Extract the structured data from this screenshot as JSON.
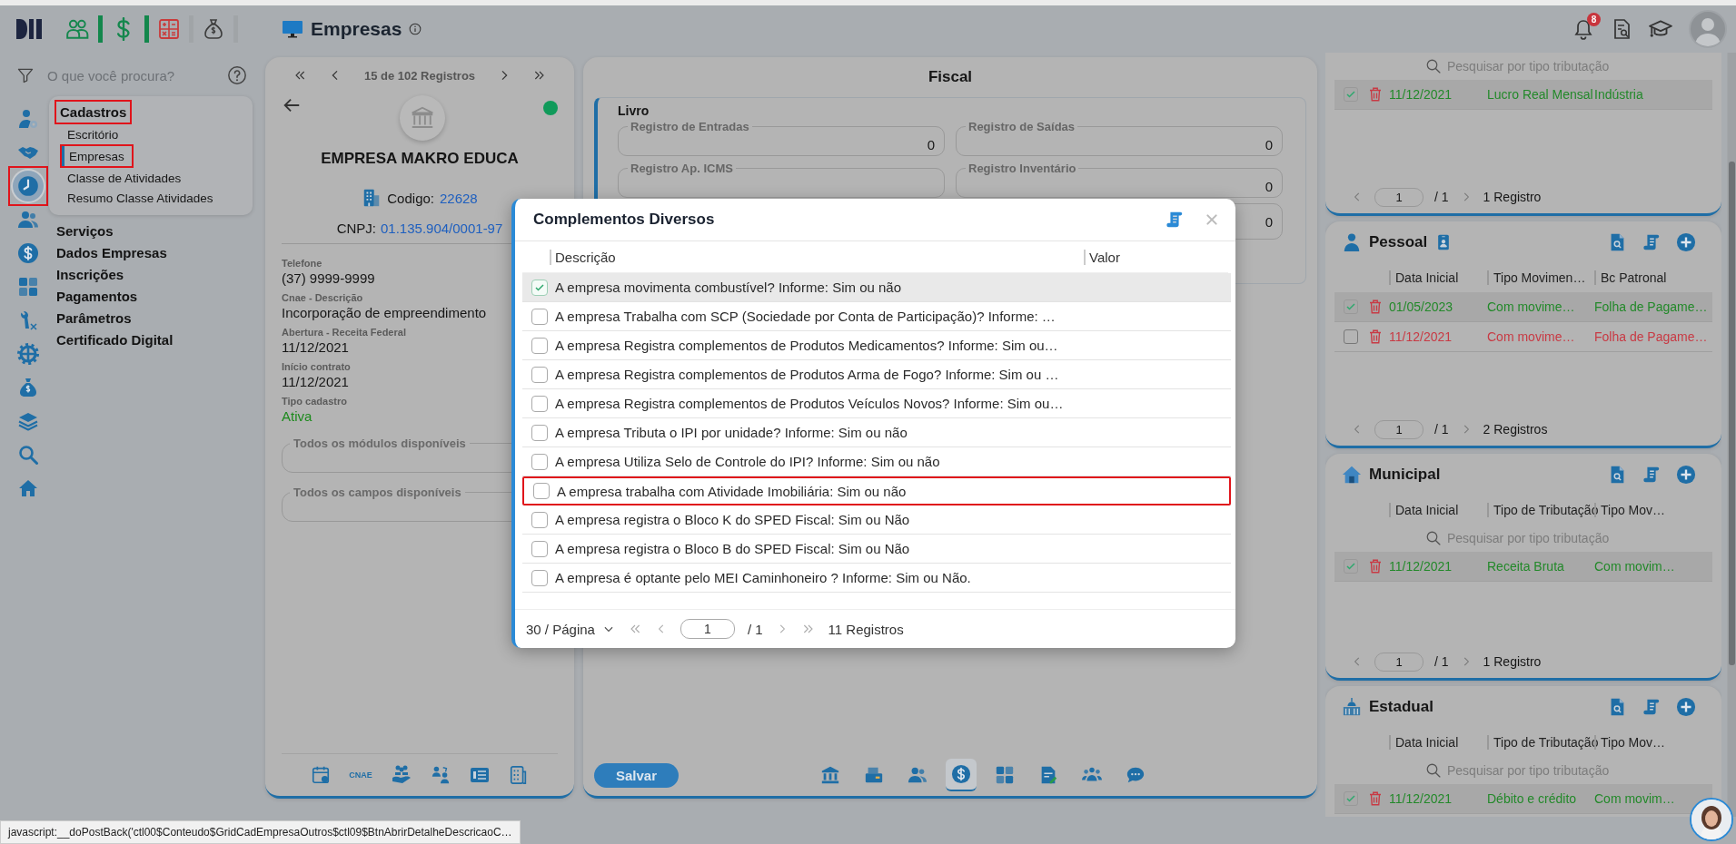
{
  "header": {
    "title": "Empresas",
    "notifications": "8"
  },
  "nav": {
    "search_placeholder": "O que você procura?",
    "rail": [
      {
        "selected": false,
        "highlighted": false
      },
      {
        "selected": false,
        "highlighted": false
      },
      {
        "selected": true,
        "highlighted": true
      },
      {
        "selected": false,
        "highlighted": false
      },
      {
        "selected": false,
        "highlighted": false
      },
      {
        "selected": false,
        "highlighted": false
      },
      {
        "selected": false,
        "highlighted": false
      },
      {
        "selected": false,
        "highlighted": false
      },
      {
        "selected": false,
        "highlighted": false
      },
      {
        "selected": false,
        "highlighted": false
      },
      {
        "selected": false,
        "highlighted": false
      },
      {
        "selected": false,
        "highlighted": false
      }
    ],
    "menu": [
      {
        "label": "Cadastros",
        "highlighted": true,
        "children": [
          {
            "label": "Escritório",
            "selected": false,
            "highlighted": false
          },
          {
            "label": "Empresas",
            "selected": true,
            "highlighted": true
          },
          {
            "label": "Classe de Atividades",
            "selected": false,
            "highlighted": false
          },
          {
            "label": "Resumo Classe Atividades",
            "selected": false,
            "highlighted": false
          }
        ]
      },
      {
        "label": "Serviços",
        "highlighted": false
      },
      {
        "label": "Dados Empresas",
        "highlighted": false
      },
      {
        "label": "Inscrições",
        "highlighted": false
      },
      {
        "label": "Pagamentos",
        "highlighted": false
      },
      {
        "label": "Parâmetros",
        "highlighted": false
      },
      {
        "label": "Certificado Digital",
        "highlighted": false
      }
    ]
  },
  "company": {
    "pager": "15 de 102 Registros",
    "name": "EMPRESA MAKRO EDUCA",
    "active": true,
    "code_label": "Codigo:",
    "code": "22628",
    "cnpj_label": "CNPJ:",
    "cnpj": "01.135.904/0001-97",
    "fields": [
      {
        "label": "Telefone",
        "value": "(37) 9999-9999",
        "kind": "text"
      },
      {
        "label": "Cnae - Descrição",
        "value": "Incorporação de empreendimento",
        "kind": "text"
      },
      {
        "label": "Abertura - Receita Federal",
        "value": "11/12/2021",
        "kind": "text"
      },
      {
        "label": "Início contrato",
        "value": "11/12/2021",
        "kind": "text"
      },
      {
        "label": "Tipo cadastro",
        "value": "Ativa",
        "kind": "status"
      }
    ],
    "groups": [
      "Todos os módulos disponíveis",
      "Todos os campos disponíveis"
    ],
    "footer_label": "CNAE"
  },
  "fiscal": {
    "title": "Fiscal",
    "section": "Livro",
    "rows": [
      [
        {
          "label": "Registro de Entradas",
          "value": "0"
        },
        {
          "label": "Registro de Saídas",
          "value": "0"
        }
      ],
      [
        {
          "label": "Registro Ap. ICMS"
        },
        {
          "label": "Registro Inventário",
          "value": "0"
        }
      ],
      [
        null,
        {
          "value": "0"
        }
      ]
    ],
    "save": "Salvar",
    "tabs": [
      {
        "selected": false
      },
      {
        "selected": false
      },
      {
        "selected": false
      },
      {
        "selected": true
      },
      {
        "selected": false
      },
      {
        "selected": false
      },
      {
        "selected": false
      },
      {
        "selected": false
      }
    ]
  },
  "right": [
    {
      "search": "Pesquisar por tipo tributação",
      "rows": [
        {
          "checked": true,
          "selected": true,
          "color": "#23892a",
          "cells": [
            "11/12/2021",
            "Lucro Real Mensal",
            "Indústria"
          ]
        }
      ],
      "page": "1",
      "pages": "/ 1",
      "total": "1 Registro"
    },
    {
      "title": "Pessoal",
      "columns": [
        "Data Inicial",
        "Tipo Movimen…",
        "Bc Patronal"
      ],
      "rows": [
        {
          "checked": true,
          "selected": true,
          "color": "#23892a",
          "cells": [
            "01/05/2023",
            "Com movime…",
            "Folha de Pagame…"
          ]
        },
        {
          "checked": false,
          "selected": false,
          "color": "#c83a44",
          "cells": [
            "11/12/2021",
            "Com movime…",
            "Folha de Pagame…"
          ]
        }
      ],
      "page": "1",
      "pages": "/ 1",
      "total": "2 Registros"
    },
    {
      "title": "Municipal",
      "columns": [
        "Data Inicial",
        "Tipo de Tributação",
        "Tipo Mov…"
      ],
      "search": "Pesquisar por tipo tributação",
      "rows": [
        {
          "checked": true,
          "selected": true,
          "color": "#23892a",
          "cells": [
            "11/12/2021",
            "Receita Bruta",
            "Com movim…"
          ]
        }
      ],
      "page": "1",
      "pages": "/ 1",
      "total": "1 Registro"
    },
    {
      "title": "Estadual",
      "columns": [
        "Data Inicial",
        "Tipo de Tributação",
        "Tipo Mov…"
      ],
      "search": "Pesquisar por tipo tributação",
      "rows": [
        {
          "checked": true,
          "selected": true,
          "color": "#23892a",
          "cells": [
            "11/12/2021",
            "Débito e crédito",
            "Com movim…"
          ]
        }
      ]
    }
  ],
  "modal": {
    "title": "Complementos Diversos",
    "columns": [
      "Descrição",
      "Valor"
    ],
    "rows": [
      {
        "text": "A empresa movimenta combustível? Informe: Sim ou não",
        "checked": true,
        "selected": true,
        "highlighted": false
      },
      {
        "text": "A empresa Trabalha com SCP (Sociedade por Conta de Participação)? Informe: …",
        "checked": false,
        "selected": false,
        "highlighted": false
      },
      {
        "text": "A empresa Registra complementos de Produtos Medicamentos? Informe: Sim ou…",
        "checked": false,
        "selected": false,
        "highlighted": false
      },
      {
        "text": "A empresa Registra complementos de Produtos Arma de Fogo? Informe: Sim ou …",
        "checked": false,
        "selected": false,
        "highlighted": false
      },
      {
        "text": "A empresa Registra complementos de Produtos Veículos Novos? Informe: Sim ou…",
        "checked": false,
        "selected": false,
        "highlighted": false
      },
      {
        "text": "A empresa Tributa o IPI por unidade? Informe: Sim ou não",
        "checked": false,
        "selected": false,
        "highlighted": false
      },
      {
        "text": "A empresa Utiliza Selo de Controle do IPI? Informe: Sim ou não",
        "checked": false,
        "selected": false,
        "highlighted": false
      },
      {
        "text": "A empresa trabalha com Atividade Imobiliária: Sim ou não",
        "checked": false,
        "selected": false,
        "highlighted": true
      },
      {
        "text": "A empresa registra o Bloco K do SPED Fiscal: Sim ou Não",
        "checked": false,
        "selected": false,
        "highlighted": false
      },
      {
        "text": "A empresa registra o Bloco B do SPED Fiscal: Sim ou Não",
        "checked": false,
        "selected": false,
        "highlighted": false
      },
      {
        "text": "A empresa é optante pelo MEI Caminhoneiro ? Informe: Sim ou Não.",
        "checked": false,
        "selected": false,
        "highlighted": false
      }
    ],
    "page_size": "30 / Página",
    "page": "1",
    "pages": "/ 1",
    "total": "11 Registros"
  },
  "status_bar": "javascript:__doPostBack('ctl00$Conteudo$GridCadEmpresaOutros$ctl09$BtnAbrirDetalheDescricaoC…"
}
